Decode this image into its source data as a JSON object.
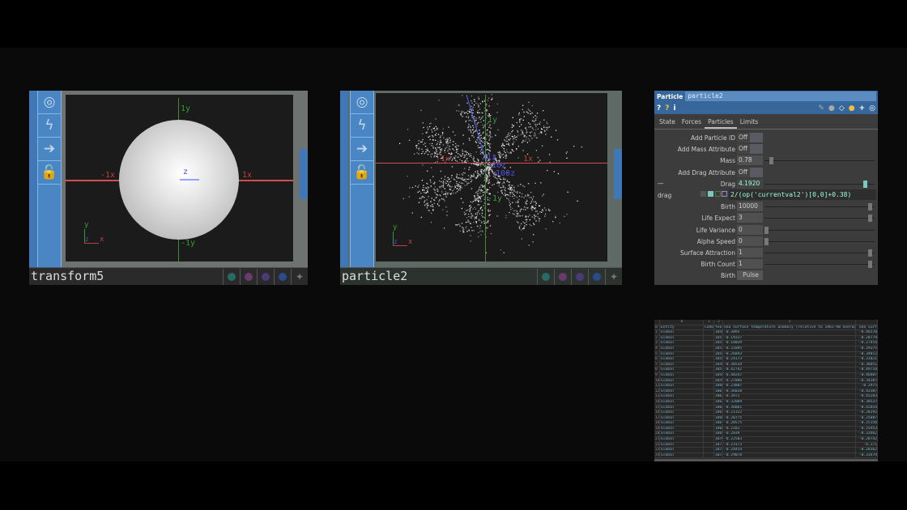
{
  "viewers": [
    {
      "name": "transform5",
      "axes": {
        "y_pos": "1y",
        "y_neg": "-1y",
        "x_pos": "1x",
        "x_neg": "-1x",
        "z": "z"
      },
      "gizmo": {
        "x": "x",
        "y": "y",
        "z": "z"
      }
    },
    {
      "name": "particle2",
      "axes": {
        "y_pos": "1y",
        "y_neg": "-1y",
        "x_pos": "1x",
        "x_neg": "-1x",
        "z": "1z",
        "z2": "-10z",
        "z3": "-100z"
      },
      "gizmo": {
        "x": "x",
        "y": "y",
        "z": "z"
      }
    }
  ],
  "param_panel": {
    "type": "Particle",
    "name": "particle2",
    "tabs": [
      "State",
      "Forces",
      "Particles",
      "Limits"
    ],
    "active_tab": "Particles",
    "params": [
      {
        "label": "Add Particle ID",
        "value": "Off",
        "kind": "toggle"
      },
      {
        "label": "Add Mass Attribute",
        "value": "Off",
        "kind": "toggle"
      },
      {
        "label": "Mass",
        "value": "0.78",
        "kind": "slider",
        "fraction": 0.05
      },
      {
        "label": "Add Drag Attribute",
        "value": "Off",
        "kind": "toggle"
      },
      {
        "label": "Drag",
        "value": "4.1920",
        "kind": "slider",
        "fraction": 0.95,
        "active": true
      },
      {
        "label": "Birth",
        "value": "10000",
        "kind": "slider",
        "fraction": 1
      },
      {
        "label": "Life Expect",
        "value": "3",
        "kind": "slider",
        "fraction": 1
      },
      {
        "label": "Life Variance",
        "value": "0",
        "kind": "slider",
        "fraction": 0
      },
      {
        "label": "Alpha Speed",
        "value": "0",
        "kind": "slider",
        "fraction": 0
      },
      {
        "label": "Surface Attraction",
        "value": "1",
        "kind": "slider",
        "fraction": 1
      },
      {
        "label": "Birth Count",
        "value": "1",
        "kind": "slider",
        "fraction": 1
      },
      {
        "label": "Birth",
        "value": "Pulse",
        "kind": "button"
      }
    ],
    "drag_expr_label": "drag",
    "drag_dash": "—",
    "drag_expression": "2/(op('currentval2')[0,0]+0.38)"
  },
  "table": {
    "col_index": [
      "0",
      "1",
      "2",
      "3",
      ""
    ],
    "header": [
      "0",
      "Entity",
      "Code",
      "Year",
      "Sea surface temperature anomaly (relative to 1961-90 average)",
      "Sea surf"
    ],
    "rows": [
      [
        "1",
        "Global",
        "",
        "1850",
        "-0.3095",
        "-0.46570"
      ],
      [
        "2",
        "Global",
        "",
        "1851",
        "-0.19337",
        "-0.28779"
      ],
      [
        "3",
        "Global",
        "",
        "1852",
        "-0.18039",
        "-0.27454"
      ],
      [
        "4",
        "Global",
        "",
        "1853",
        "-0.21095",
        "-0.29375"
      ],
      [
        "5",
        "Global",
        "",
        "1854",
        "-0.26843",
        "-0.34812"
      ],
      [
        "6",
        "Global",
        "",
        "1855",
        "-0.24173",
        "-0.31821"
      ],
      [
        "7",
        "Global",
        "",
        "1856",
        "-0.30534",
        "-0.38051"
      ],
      [
        "8",
        "Global",
        "",
        "1857",
        "-0.42742",
        "-0.49718"
      ],
      [
        "9",
        "Global",
        "",
        "1858",
        "-0.40247",
        "-0.46887"
      ],
      [
        "10",
        "Global",
        "",
        "1859",
        "-0.27096",
        "-0.34387"
      ],
      [
        "11",
        "Global",
        "",
        "1860",
        "-0.23087",
        "-0.2975"
      ],
      [
        "12",
        "Global",
        "",
        "1861",
        "-0.36028",
        "-0.42387"
      ],
      [
        "13",
        "Global",
        "",
        "1862",
        "-0.3972",
        "-0.45283"
      ],
      [
        "14",
        "Global",
        "",
        "1863",
        "-0.32089",
        "-0.38537"
      ],
      [
        "15",
        "Global",
        "",
        "1864",
        "-0.36061",
        "-0.42014"
      ],
      [
        "16",
        "Global",
        "",
        "1865",
        "-0.21322",
        "-0.28292"
      ],
      [
        "17",
        "Global",
        "",
        "1866",
        "-0.20775",
        "-0.25887"
      ],
      [
        "18",
        "Global",
        "",
        "1867",
        "-0.20575",
        "-0.25158"
      ],
      [
        "19",
        "Global",
        "",
        "1868",
        "-0.2101",
        "-0.25953"
      ],
      [
        "20",
        "Global",
        "",
        "1869",
        "-0.2839",
        "-0.32662"
      ],
      [
        "21",
        "Global",
        "",
        "1870",
        "-0.22583",
        "-0.28742"
      ],
      [
        "22",
        "Global",
        "",
        "1871",
        "-0.23173",
        "-0.271"
      ],
      [
        "23",
        "Global",
        "",
        "1872",
        "-0.24454",
        "-0.28362"
      ],
      [
        "24",
        "Global",
        "",
        "1873",
        "-0.29078",
        "-0.33479"
      ]
    ]
  }
}
